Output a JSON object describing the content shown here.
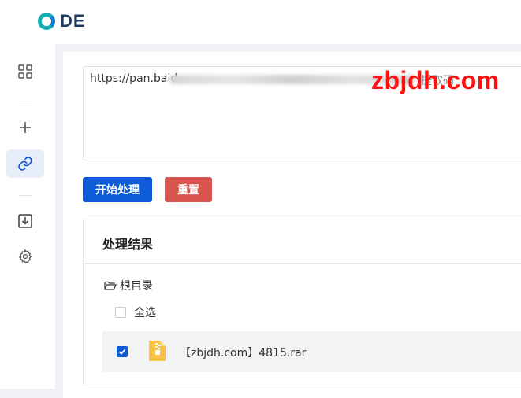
{
  "app": {
    "logo_text": "DE"
  },
  "sidebar": {
    "items": [
      {
        "icon": "grid-icon",
        "active": false
      },
      {
        "icon": "plus-icon",
        "active": false
      },
      {
        "icon": "link-icon",
        "active": true
      },
      {
        "icon": "download-icon",
        "active": false
      },
      {
        "icon": "gear-icon",
        "active": false
      }
    ]
  },
  "input": {
    "url_prefix": "https://pan.baid",
    "url_suffix": "提取码",
    "watermark": "zbjdh.com"
  },
  "actions": {
    "start_label": "开始处理",
    "reset_label": "重置"
  },
  "result": {
    "title": "处理结果",
    "root_label": "根目录",
    "select_all_label": "全选",
    "files": [
      {
        "name": "【zbjdh.com】4815.rar",
        "checked": true
      }
    ]
  },
  "colors": {
    "primary": "#0d5bd7",
    "danger": "#d9534f",
    "logo_teal": "#14b0b8",
    "watermark": "#ff1010"
  }
}
